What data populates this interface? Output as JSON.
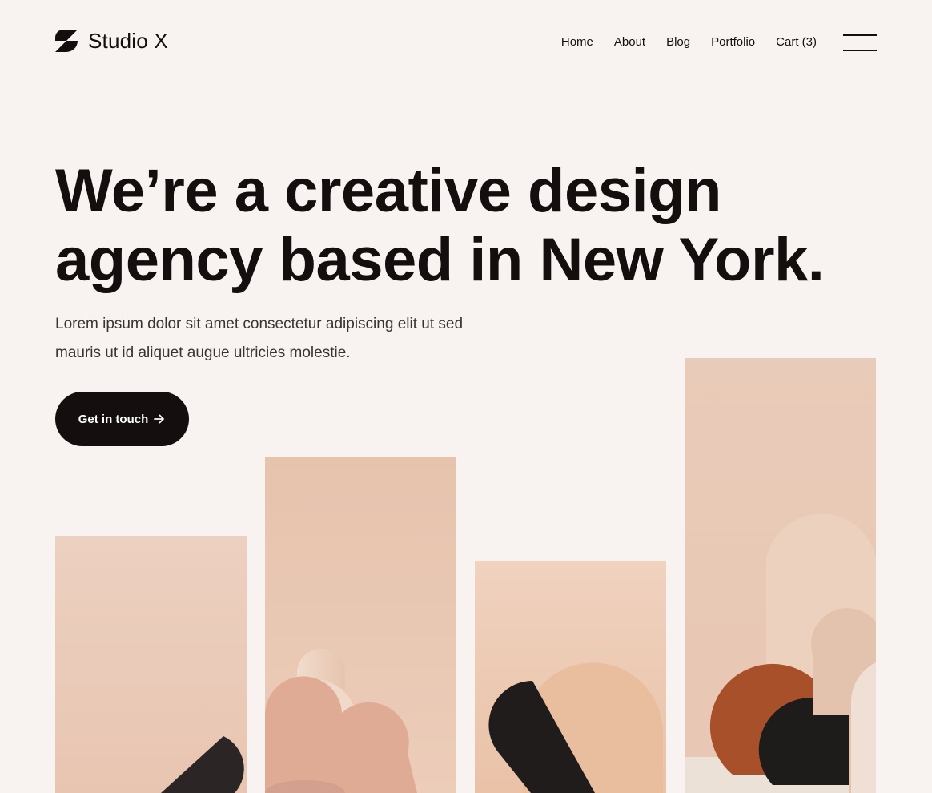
{
  "brand": {
    "name": "Studio X",
    "logo_icon": "studio-x-logo-icon"
  },
  "nav": {
    "items": [
      {
        "label": "Home"
      },
      {
        "label": "About"
      },
      {
        "label": "Blog"
      },
      {
        "label": "Portfolio"
      },
      {
        "label": "Cart (3)"
      }
    ],
    "menu_icon": "hamburger-menu-icon"
  },
  "hero": {
    "title_lines": [
      "We’re a creative design",
      "agency based in New York."
    ],
    "description_lines": [
      "Lorem ipsum dolor sit amet consectetur adipiscing elit ut sed",
      "mauris ut id aliquet augue ultricies molestie."
    ],
    "cta_label": "Get in touch",
    "cta_icon": "arrow-right-icon"
  },
  "gallery": {
    "images": [
      {
        "icon": "abstract-shapes-image"
      },
      {
        "icon": "abstract-shapes-image"
      },
      {
        "icon": "abstract-shapes-image"
      },
      {
        "icon": "abstract-shapes-image"
      }
    ]
  },
  "colors": {
    "background": "#f8f3f0",
    "text": "#140e0e",
    "button": "#140e0e",
    "photo_peach": "#e9c8b4",
    "accent_rust": "#a8502a"
  }
}
